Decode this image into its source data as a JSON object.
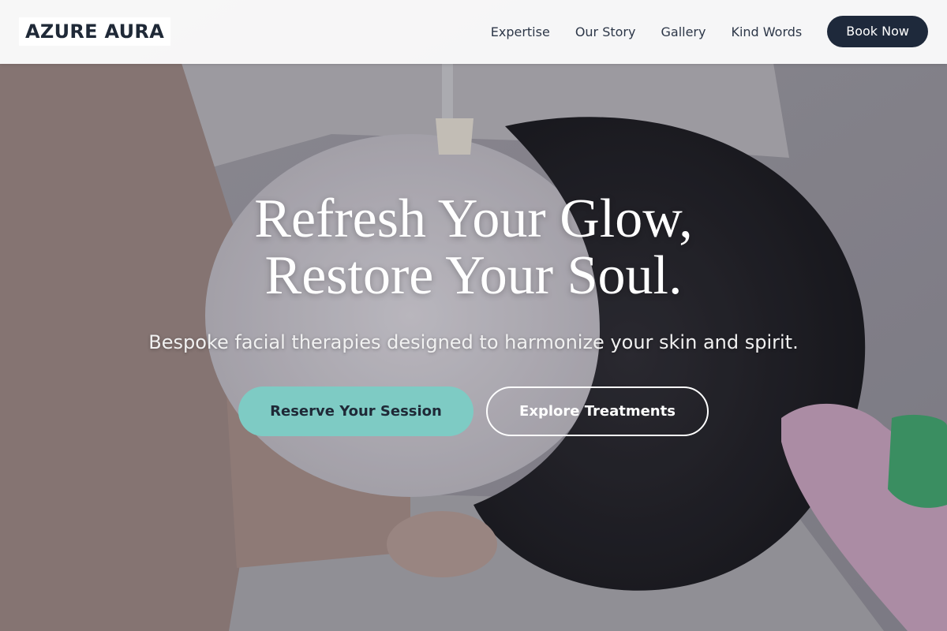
{
  "brand": {
    "logo_text": "AZURE AURA"
  },
  "nav": {
    "links": [
      {
        "label": "Expertise"
      },
      {
        "label": "Our Story"
      },
      {
        "label": "Gallery"
      },
      {
        "label": "Kind Words"
      }
    ],
    "cta_label": "Book Now"
  },
  "hero": {
    "title_line1": "Refresh Your Glow,",
    "title_line2": "Restore Your Soul.",
    "subtitle": "Bespoke facial therapies designed to harmonize your skin and spirit.",
    "primary_cta": "Reserve Your Session",
    "secondary_cta": "Explore Treatments",
    "background_image": "spa-facial-photo"
  },
  "colors": {
    "accent": "#7ecbc4",
    "dark": "#1e293b",
    "header_bg": "#ffffff"
  }
}
